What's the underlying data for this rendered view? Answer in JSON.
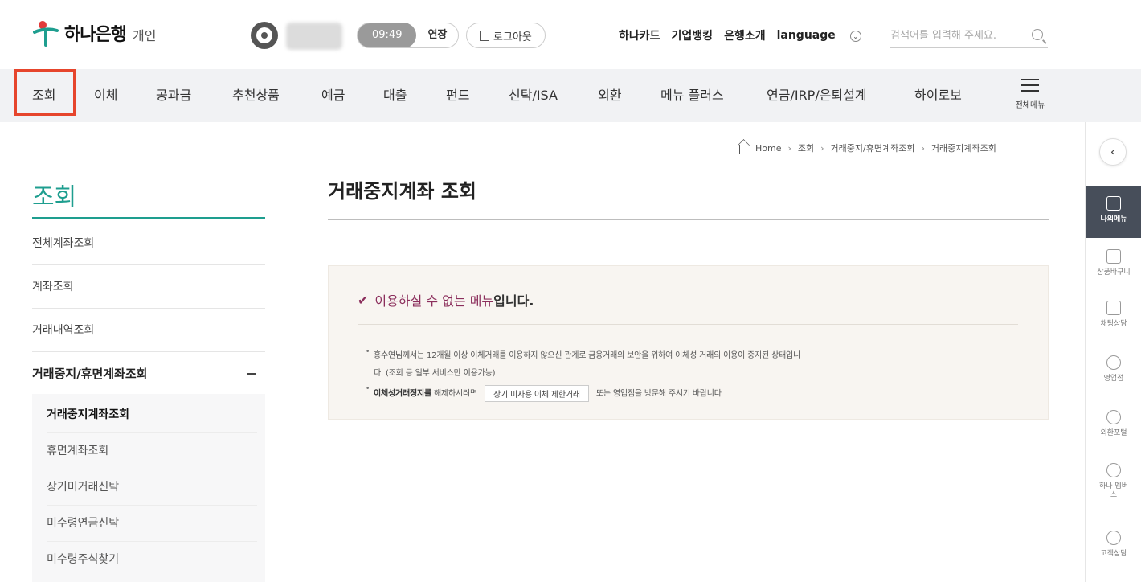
{
  "brand": {
    "name": "하나은행",
    "sub": "개인"
  },
  "session": {
    "time": "09:49",
    "extend": "연장",
    "logout": "로그아웃"
  },
  "top_links": [
    "하나카드",
    "기업뱅킹",
    "은행소개",
    "language"
  ],
  "search": {
    "placeholder": "검색어를 입력해 주세요."
  },
  "nav": {
    "items": [
      "조회",
      "이체",
      "공과금",
      "추천상품",
      "예금",
      "대출",
      "펀드",
      "신탁/ISA",
      "외환",
      "메뉴 플러스",
      "연금/IRP/은퇴설계",
      "하이로보"
    ],
    "all_menu": "전체메뉴"
  },
  "breadcrumb": [
    "Home",
    "조회",
    "거래중지/휴면계좌조회",
    "거래중지계좌조회"
  ],
  "sidebar": {
    "title": "조회",
    "items": [
      "전체계좌조회",
      "계좌조회",
      "거래내역조회",
      "거래중지/휴면계좌조회"
    ],
    "sub_items": [
      "거래중지계좌조회",
      "휴면계좌조회",
      "장기미거래신탁",
      "미수령연금신탁",
      "미수령주식찾기"
    ]
  },
  "main": {
    "title": "거래중지계좌 조회",
    "notice": {
      "head_accent": "이용하실 수 없는 메뉴",
      "head_rest": "입니다.",
      "line1": "홍수연님께서는 12개월 이상 이체거래를 이용하지 않으신 관계로 금융거래의 보안을 위하여 이체성 거래의 이용이 중지된 상태입니",
      "line2": "다. (조회 등 일부 서비스만 이용가능)",
      "line3_strong": "이체성거래정지를",
      "line3_pre": "해제하시려면",
      "line3_button": "장기 미사용 이체 제한거래",
      "line3_post": "또는 영업점을 방문해 주시기 바랍니다"
    }
  },
  "rail": {
    "collapse": "‹",
    "items": [
      "나의메뉴",
      "상품바구니",
      "채팅상담",
      "영업점",
      "외환포털",
      "하나 멤버스",
      "고객상담"
    ]
  },
  "colors": {
    "accent_teal": "#1e9e8f",
    "notice_accent": "#8b2e5c",
    "highlight": "#e6452c",
    "rail_active": "#474e5a"
  }
}
